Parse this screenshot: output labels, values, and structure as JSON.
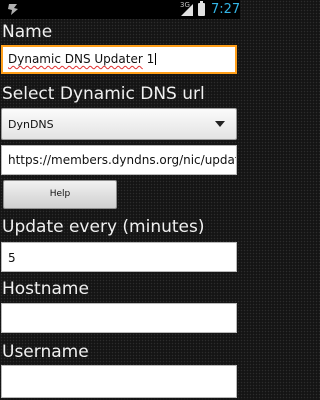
{
  "status_bar": {
    "network_type": "3G",
    "time": "7:27",
    "icons": [
      "notification-icon",
      "signal-icon",
      "battery-icon"
    ]
  },
  "form": {
    "name_label": "Name",
    "name_value": "Dynamic DNS Updater 1",
    "url_select_label": "Select Dynamic DNS url",
    "url_select_value": "DynDNS",
    "url_value": "https://members.dyndns.org/nic/update",
    "help_label": "Help",
    "update_every_label": "Update every (minutes)",
    "update_every_value": "5",
    "hostname_label": "Hostname",
    "hostname_value": "",
    "username_label": "Username",
    "username_value": ""
  },
  "colors": {
    "clock": "#33b5e5",
    "focus_border": "#ff9f1a"
  }
}
